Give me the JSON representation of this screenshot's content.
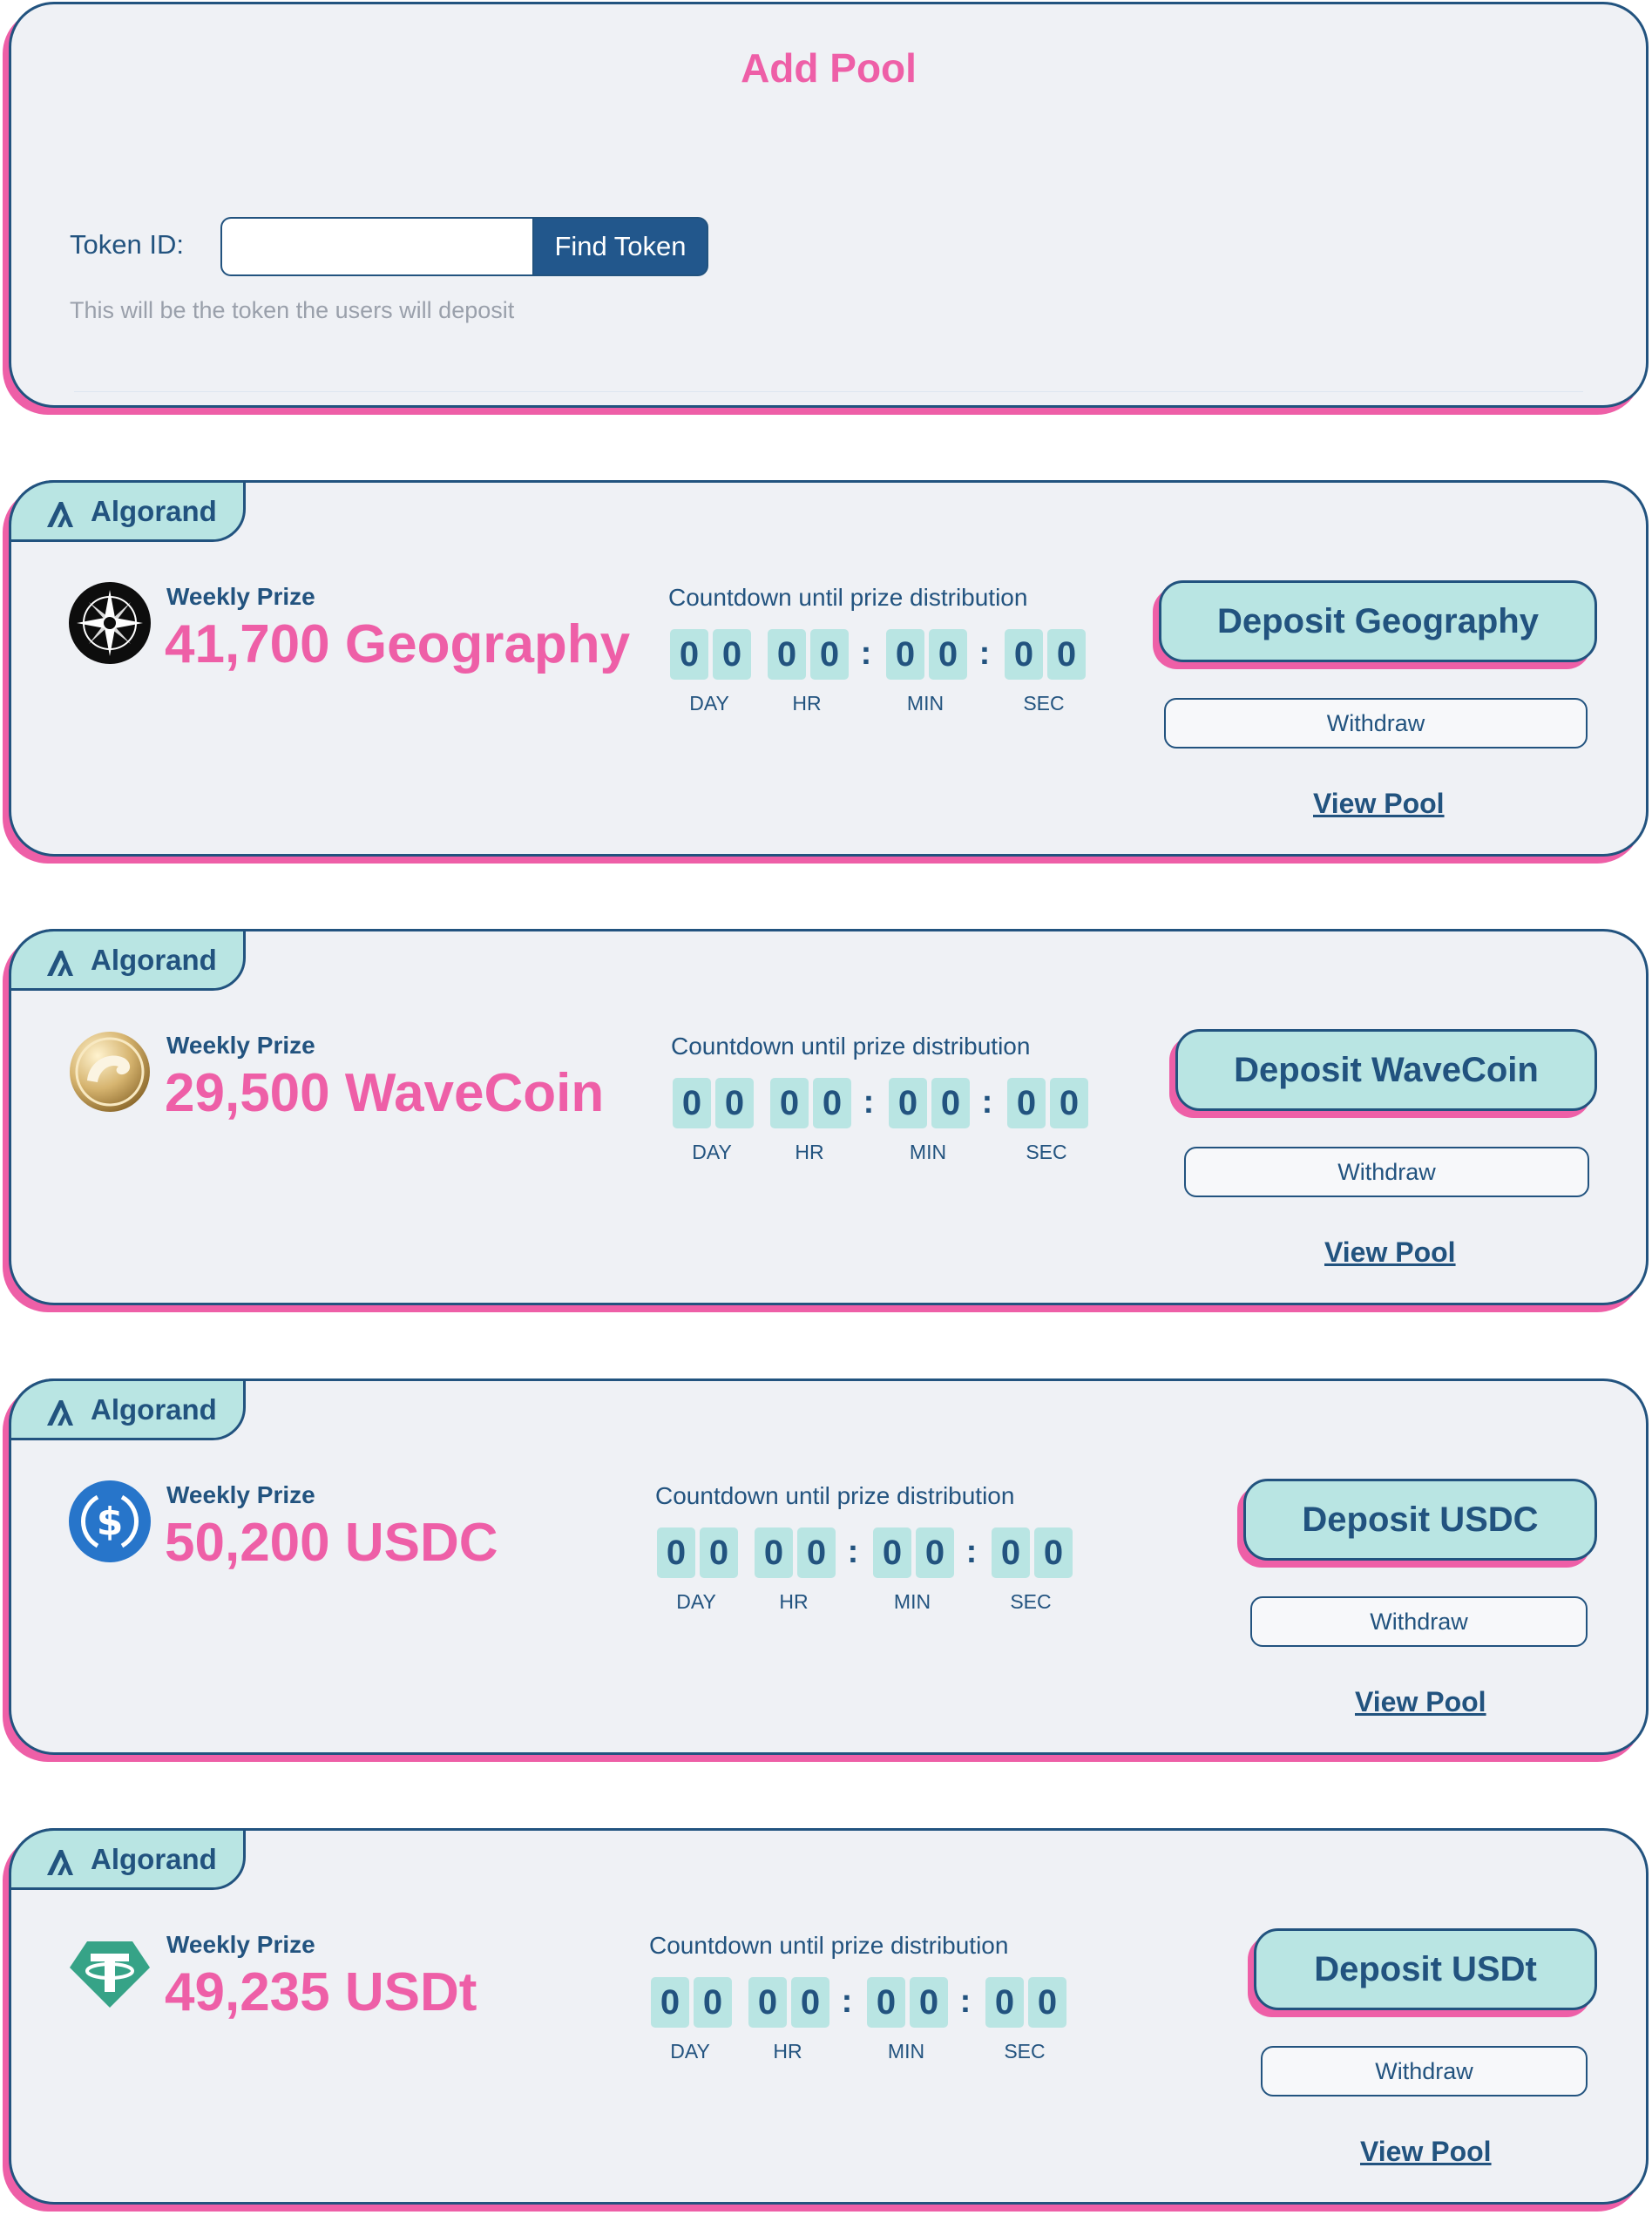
{
  "add_pool": {
    "title": "Add Pool",
    "token_label": "Token ID:",
    "token_input_value": "",
    "find_button": "Find Token",
    "hint": "This will be the token the users will deposit"
  },
  "countdown_title": "Countdown until prize distribution",
  "countdown_units": [
    "DAY",
    "HR",
    "MIN",
    "SEC"
  ],
  "pools": [
    {
      "chain": "Algorand",
      "icon": "compass-star-icon",
      "prize_label": "Weekly Prize",
      "prize": "41,700 Geography",
      "countdown": [
        "0",
        "0",
        "0",
        "0",
        "0",
        "0",
        "0",
        "0"
      ],
      "deposit": "Deposit Geography",
      "withdraw": "Withdraw",
      "view": "View Pool"
    },
    {
      "chain": "Algorand",
      "icon": "wave-coin-icon",
      "prize_label": "Weekly Prize",
      "prize": "29,500 WaveCoin",
      "countdown": [
        "0",
        "0",
        "0",
        "0",
        "0",
        "0",
        "0",
        "0"
      ],
      "deposit": "Deposit WaveCoin",
      "withdraw": "Withdraw",
      "view": "View Pool"
    },
    {
      "chain": "Algorand",
      "icon": "usdc-icon",
      "prize_label": "Weekly Prize",
      "prize": "50,200 USDC",
      "countdown": [
        "0",
        "0",
        "0",
        "0",
        "0",
        "0",
        "0",
        "0"
      ],
      "deposit": "Deposit USDC",
      "withdraw": "Withdraw",
      "view": "View Pool"
    },
    {
      "chain": "Algorand",
      "icon": "tether-icon",
      "prize_label": "Weekly Prize",
      "prize": "49,235 USDt",
      "countdown": [
        "0",
        "0",
        "0",
        "0",
        "0",
        "0",
        "0",
        "0"
      ],
      "deposit": "Deposit USDt",
      "withdraw": "Withdraw",
      "view": "View Pool"
    }
  ],
  "colors": {
    "navy": "#22537f",
    "pink": "#ee5fa7",
    "teal": "#b9e5e3",
    "card_bg": "#eff1f5"
  }
}
